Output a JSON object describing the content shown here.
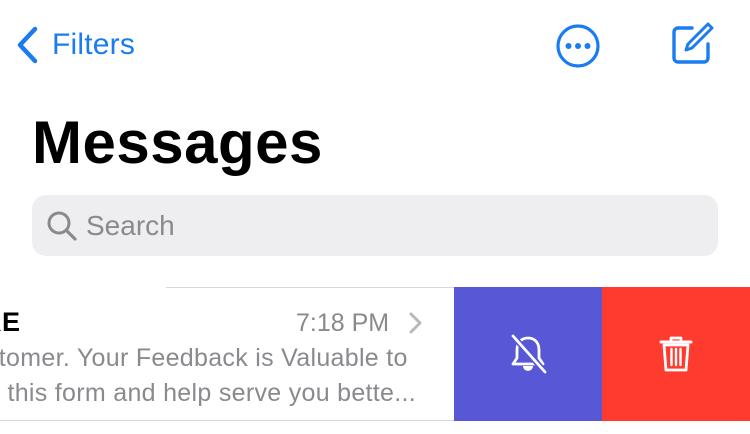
{
  "nav": {
    "back_label": "Filters",
    "icons": {
      "back": "chevron-left-icon",
      "more": "ellipsis-circle-icon",
      "compose": "compose-icon"
    }
  },
  "title": "Messages",
  "search": {
    "placeholder": "Search",
    "icon": "magnifying-glass-icon"
  },
  "messages": [
    {
      "sender_visible": "RE",
      "time": "7:18 PM",
      "preview_line1": "stomer. Your Feedback is Valuable to",
      "preview_line2": "n this form and help serve you bette...",
      "swipe_actions": [
        {
          "name": "mute",
          "icon": "bell-slash-icon",
          "color": "#5857d6"
        },
        {
          "name": "delete",
          "icon": "trash-icon",
          "color": "#ff3b30"
        }
      ]
    }
  ],
  "colors": {
    "accent": "#1a7cf0",
    "secondary_text": "#8a8a8e",
    "search_bg": "#eeeef0"
  }
}
